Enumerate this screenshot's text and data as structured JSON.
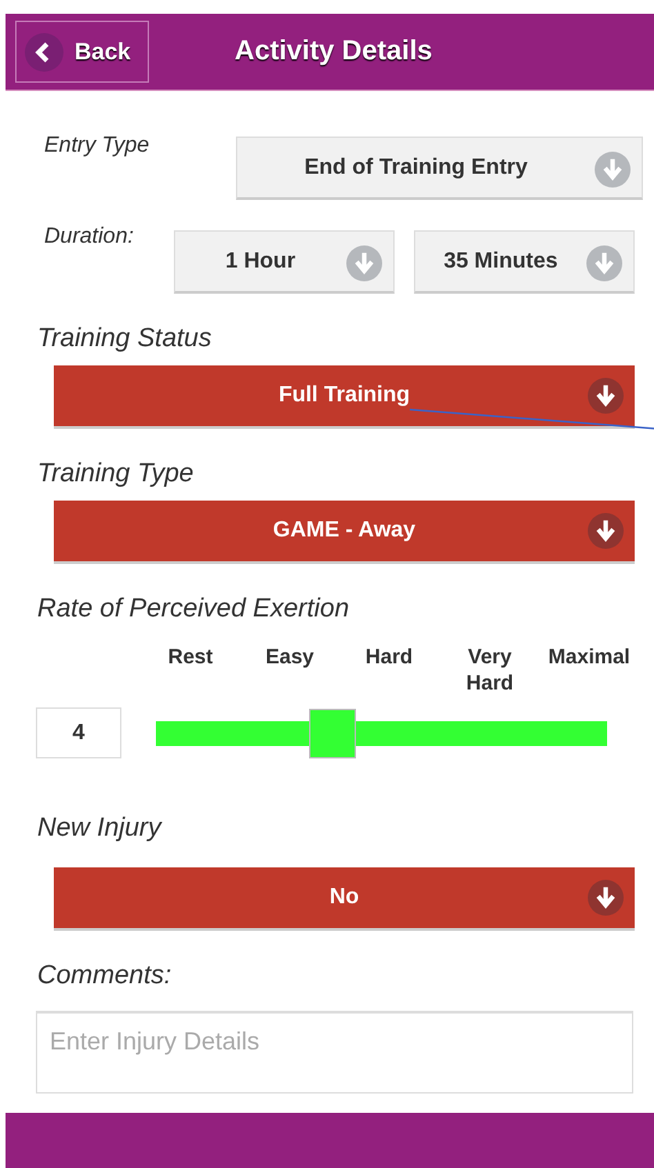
{
  "header": {
    "back": "Back",
    "title": "Activity Details"
  },
  "entry_type": {
    "label": "Entry Type",
    "value": "End of Training Entry"
  },
  "duration": {
    "label": "Duration:",
    "hours": "1 Hour",
    "minutes": "35 Minutes"
  },
  "selects": [
    {
      "label": "Training Status",
      "value": "Full Training"
    },
    {
      "label": "Training Type",
      "value": "GAME - Away"
    }
  ],
  "exertion": {
    "label": "Rate of Perceived Exertion",
    "scale": [
      "Rest",
      "Easy",
      "Hard",
      "Very Hard",
      "Maximal"
    ],
    "value": "4",
    "level": 0.39
  },
  "injury": {
    "label": "New Injury",
    "value": "No"
  },
  "comments": {
    "label": "Comments:",
    "placeholder": "Enter Injury Details"
  }
}
